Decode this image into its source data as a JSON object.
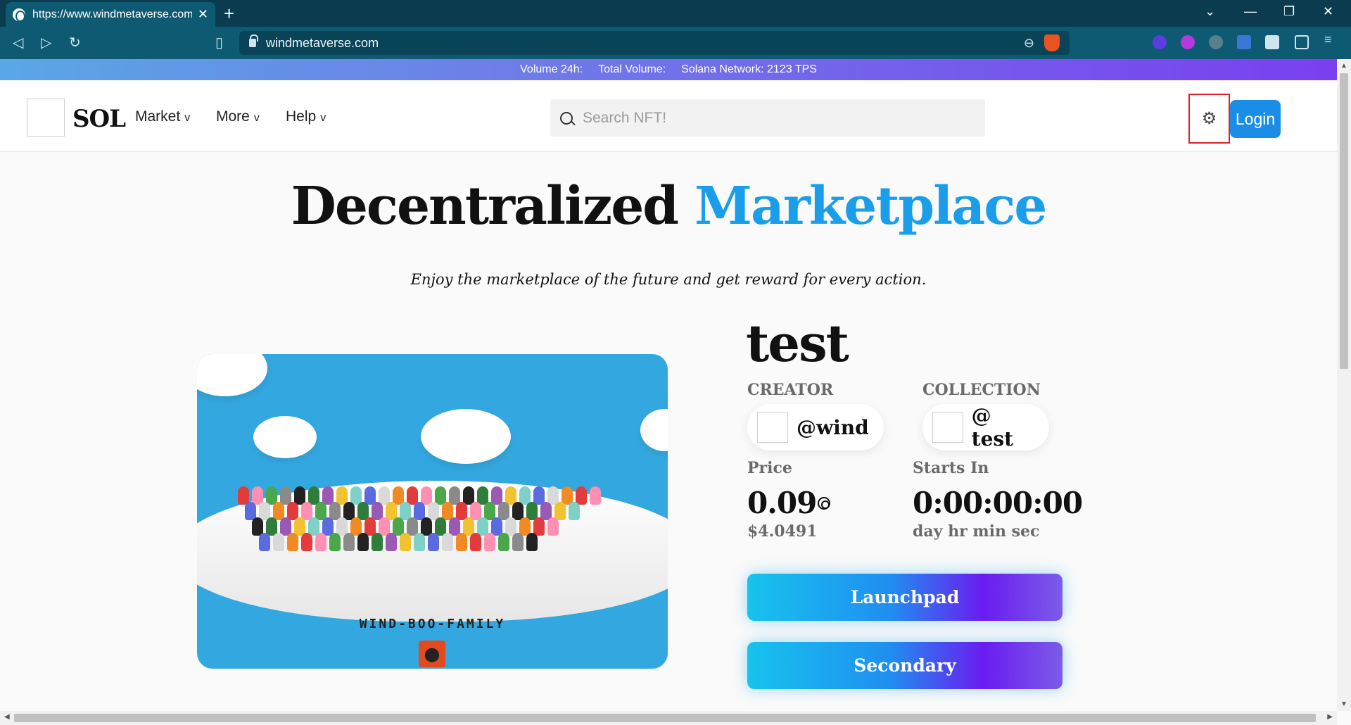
{
  "browser": {
    "tab_title": "https://www.windmetaverse.com",
    "tab_close": "✕",
    "new_tab": "+",
    "address": "windmetaverse.com",
    "window_controls": {
      "tabs_dropdown": "⌄",
      "minimize": "—",
      "restore": "❐",
      "close": "✕"
    },
    "nav_icons": {
      "back": "◁",
      "forward": "▷",
      "reload": "↻",
      "bookmark": "▯"
    }
  },
  "banner": {
    "volume_24h": "Volume 24h:",
    "total_volume": "Total Volume:",
    "network": "Solana Network: 2123 TPS"
  },
  "header": {
    "logo_text": "SOL",
    "menu": [
      {
        "label": "Market",
        "chevron": "v"
      },
      {
        "label": "More",
        "chevron": "v"
      },
      {
        "label": "Help",
        "chevron": "v"
      }
    ],
    "search_placeholder": "Search NFT!",
    "settings_icon": "⚙",
    "login": "Login"
  },
  "hero": {
    "title_main": "Decentralized",
    "title_accent": "Marketplace",
    "tagline": "Enjoy the marketplace of the future and get reward for every action."
  },
  "nft": {
    "image_label": "WIND-BOO-FAMILY",
    "badge_icon": "⬤",
    "name": "test",
    "creator_label": "CREATOR",
    "creator": "@wind",
    "collection_label": "COLLECTION",
    "collection": "@ test",
    "price_label": "Price",
    "price": "0.09",
    "price_usd": "$4.0491",
    "starts_label": "Starts In",
    "countdown": "0:00:00:00",
    "countdown_units": "day hr min sec"
  },
  "actions": {
    "launchpad": "Launchpad",
    "secondary": "Secondary"
  },
  "colors": {
    "accent": "#1a9ee9",
    "login_bg": "#1a8ee6",
    "chrome_dark": "#0b3b4f",
    "chrome_mid": "#0f5a73"
  }
}
